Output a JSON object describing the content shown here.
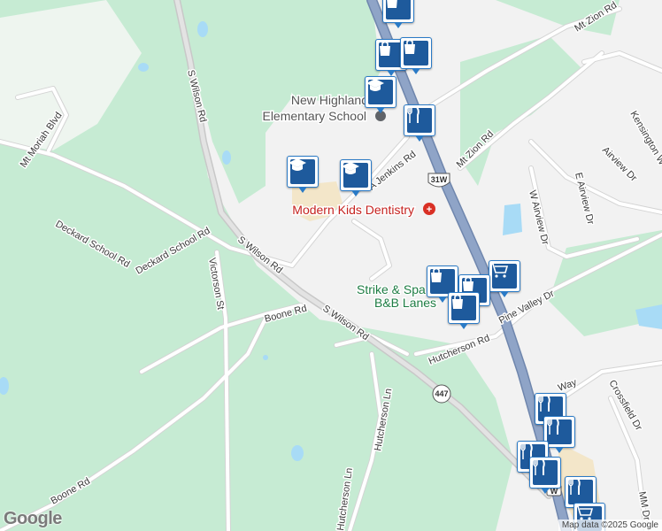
{
  "map": {
    "colors": {
      "land": "#f2f2f2",
      "park": "#c6ebd3",
      "water": "#a8dbf6",
      "road": "#ffffff",
      "road_outline": "#d4d4d4",
      "highway": "#8fa4c7",
      "highway_outline": "#6f86ad",
      "commercial": "#f3e6c9",
      "marker_fill": "#1e5a9c",
      "marker_border": "#2a7ac6"
    },
    "road_labels": {
      "s_wilson_rd_north": "S Wilson Rd",
      "s_wilson_rd_mid": "S Wilson Rd",
      "s_wilson_rd_south": "S Wilson Rd",
      "deckard_school_rd_west": "Deckard School Rd",
      "deckard_school_rd_east": "Deckard School Rd",
      "mt_moriah_blvd": "Mt Moriah Blvd",
      "victorson_st": "Victorson St",
      "boone_rd_north": "Boone Rd",
      "boone_rd_south": "Boone Rd",
      "hutcherson_ln_north": "Hutcherson Ln",
      "hutcherson_ln_south": "Hutcherson Ln",
      "hutcherson_rd": "Hutcherson Rd",
      "pine_valley_dr": "Pine Valley Dr",
      "mt_zion_rd_north": "Mt Zion Rd",
      "mt_zion_rd_mid": "Mt Zion Rd",
      "jenkins_rd": "A Jenkins Rd",
      "w_airview_dr": "W Airview Dr",
      "e_airview_dr": "E Airview Dr",
      "airview_dr": "Airview Dr",
      "kensington": "Kensington W",
      "crossfield_dr": "Crossfield Dr",
      "way": "Way",
      "mm_dr": "MM Dr"
    },
    "shields": {
      "us_31w": "31W",
      "tn_447": "447",
      "w_bottom": "W"
    },
    "poi_labels": {
      "school_name_line1": "New Highland",
      "school_name_line2": "Elementary School",
      "dentistry": "Modern Kids Dentistry",
      "bowling_line1": "Strike & Spa",
      "bowling_line2": "B&B Lanes"
    },
    "markers": [
      {
        "icon": "shopping-bag-icon"
      },
      {
        "icon": "shopping-bag-icon"
      },
      {
        "icon": "shopping-bag-icon"
      },
      {
        "icon": "graduation-cap-icon"
      },
      {
        "icon": "fork-knife-icon"
      },
      {
        "icon": "graduation-cap-icon"
      },
      {
        "icon": "graduation-cap-icon"
      },
      {
        "icon": "shopping-cart-icon"
      },
      {
        "icon": "shopping-bag-icon"
      },
      {
        "icon": "shopping-bag-icon"
      },
      {
        "icon": "shopping-bag-icon"
      },
      {
        "icon": "fork-knife-icon"
      },
      {
        "icon": "fork-knife-icon"
      },
      {
        "icon": "fork-knife-icon"
      },
      {
        "icon": "fork-knife-icon"
      },
      {
        "icon": "fork-knife-icon"
      },
      {
        "icon": "shopping-cart-icon"
      }
    ],
    "logo": "Google",
    "attribution": "Map data ©2025 Google"
  }
}
